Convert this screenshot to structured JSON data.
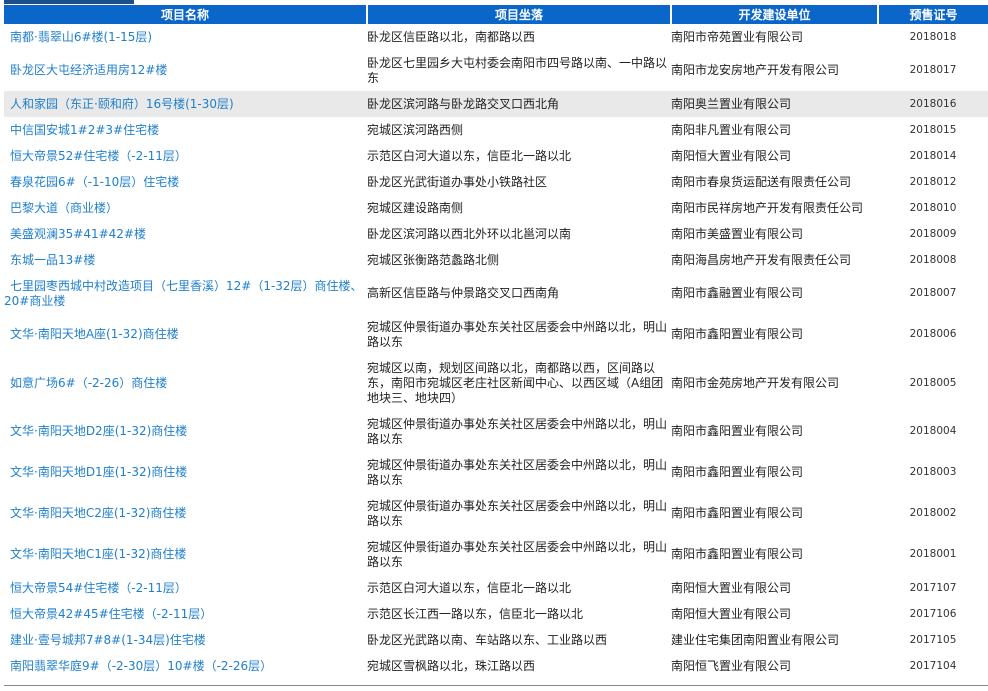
{
  "table": {
    "headers": [
      "项目名称",
      "项目坐落",
      "开发建设单位",
      "预售证号"
    ],
    "rows": [
      {
        "name": "南都·翡翠山6#楼(1-15层)",
        "location": "卧龙区信臣路以北，南都路以西",
        "developer": "南阳市帝苑置业有限公司",
        "cert": "2018018"
      },
      {
        "name": "卧龙区大屯经济适用房12#楼",
        "location": "卧龙区七里园乡大屯村委会南阳市四号路以南、一中路以东",
        "developer": "南阳市龙安房地产开发有限公司",
        "cert": "2018017"
      },
      {
        "name": "人和家园（东正·颐和府）16号楼(1-30层)",
        "location": "卧龙区滨河路与卧龙路交叉口西北角",
        "developer": "南阳奥兰置业有限公司",
        "cert": "2018016",
        "highlight": true
      },
      {
        "name": "中信国安城1#2#3#住宅楼",
        "location": "宛城区滨河路西侧",
        "developer": "南阳非凡置业有限公司",
        "cert": "2018015"
      },
      {
        "name": "恒大帝景52#住宅楼（-2-11层）",
        "location": "示范区白河大道以东，信臣北一路以北",
        "developer": "南阳恒大置业有限公司",
        "cert": "2018014"
      },
      {
        "name": "春泉花园6#（-1-10层）住宅楼",
        "location": "卧龙区光武街道办事处小铁路社区",
        "developer": "南阳市春泉货运配送有限责任公司",
        "cert": "2018012"
      },
      {
        "name": "巴黎大道（商业楼）",
        "location": "宛城区建设路南侧",
        "developer": "南阳市民祥房地产开发有限责任公司",
        "cert": "2018010"
      },
      {
        "name": "美盛观澜35#41#42#楼",
        "location": "卧龙区滨河路以西北外环以北邕河以南",
        "developer": "南阳市美盛置业有限公司",
        "cert": "2018009"
      },
      {
        "name": "东城一品13#楼",
        "location": "宛城区张衡路范蠡路北侧",
        "developer": "南阳海昌房地产开发有限责任公司",
        "cert": "2018008"
      },
      {
        "name": "七里园枣西城中村改造项目（七里香溪）12#（1-32层）商住楼、20#商业楼",
        "location": "高新区信臣路与仲景路交叉口西南角",
        "developer": "南阳市鑫融置业有限公司",
        "cert": "2018007"
      },
      {
        "name": "文华·南阳天地A座(1-32)商住楼",
        "location": "宛城区仲景街道办事处东关社区居委会中州路以北，明山路以东",
        "developer": "南阳市鑫阳置业有限公司",
        "cert": "2018006"
      },
      {
        "name": "如意广场6#（-2-26）商住楼",
        "location": "宛城区以南，规划区间路以北，南都路以西，区间路以东，南阳市宛城区老庄社区新闻中心、以西区域（A组团地块三、地块四）",
        "developer": "南阳市金苑房地产开发有限公司",
        "cert": "2018005"
      },
      {
        "name": "文华·南阳天地D2座(1-32)商住楼",
        "location": "宛城区仲景街道办事处东关社区居委会中州路以北，明山路以东",
        "developer": "南阳市鑫阳置业有限公司",
        "cert": "2018004"
      },
      {
        "name": "文华·南阳天地D1座(1-32)商住楼",
        "location": "宛城区仲景街道办事处东关社区居委会中州路以北，明山路以东",
        "developer": "南阳市鑫阳置业有限公司",
        "cert": "2018003"
      },
      {
        "name": "文华·南阳天地C2座(1-32)商住楼",
        "location": "宛城区仲景街道办事处东关社区居委会中州路以北，明山路以东",
        "developer": "南阳市鑫阳置业有限公司",
        "cert": "2018002"
      },
      {
        "name": "文华·南阳天地C1座(1-32)商住楼",
        "location": "宛城区仲景街道办事处东关社区居委会中州路以北，明山路以东",
        "developer": "南阳市鑫阳置业有限公司",
        "cert": "2018001"
      },
      {
        "name": "恒大帝景54#住宅楼（-2-11层）",
        "location": "示范区白河大道以东，信臣北一路以北",
        "developer": "南阳恒大置业有限公司",
        "cert": "2017107"
      },
      {
        "name": "恒大帝景42#45#住宅楼（-2-11层）",
        "location": "示范区长江西一路以东，信臣北一路以北",
        "developer": "南阳恒大置业有限公司",
        "cert": "2017106"
      },
      {
        "name": "建业·壹号城邦7#8#(1-34层)住宅楼",
        "location": "卧龙区光武路以南、车站路以东、工业路以西",
        "developer": "建业住宅集团南阳置业有限公司",
        "cert": "2017105"
      },
      {
        "name": "南阳翡翠华庭9#（-2-30层）10#楼（-2-26层）",
        "location": "宛城区雪枫路以北，珠江路以西",
        "developer": "南阳恒飞置业有限公司",
        "cert": "2017104"
      }
    ]
  },
  "colors": {
    "header": "#0a66c8",
    "link": "#1f7fcc",
    "highlight": "#e9e9e9"
  }
}
